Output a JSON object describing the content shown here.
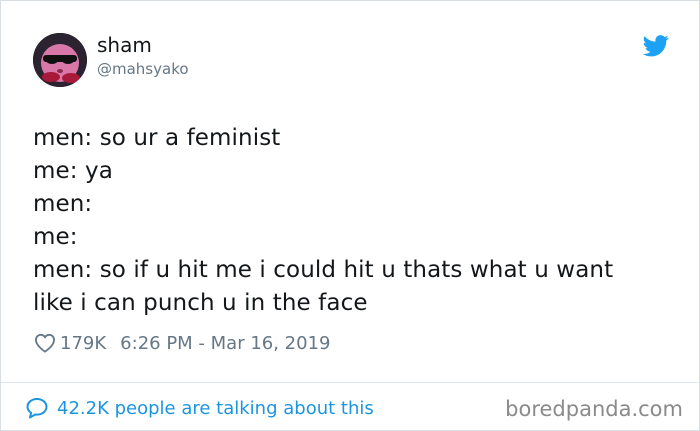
{
  "user": {
    "display_name": "sham",
    "handle": "@mahsyako",
    "avatar_icon": "avatar-kirby-sunglasses"
  },
  "tweet": {
    "lines": [
      "men: so ur a feminist",
      "me: ya",
      "men:",
      "me:",
      "men: so if u hit me i could hit u thats what u want",
      "like i can punch u in the face"
    ]
  },
  "meta": {
    "likes": "179K",
    "timestamp": "6:26 PM - Mar 16, 2019"
  },
  "footer": {
    "talking": "42.2K people are talking about this",
    "watermark": "boredpanda.com"
  },
  "colors": {
    "twitter_blue": "#1da1f2",
    "link_blue": "#1b95e0",
    "muted_text": "#657786"
  }
}
